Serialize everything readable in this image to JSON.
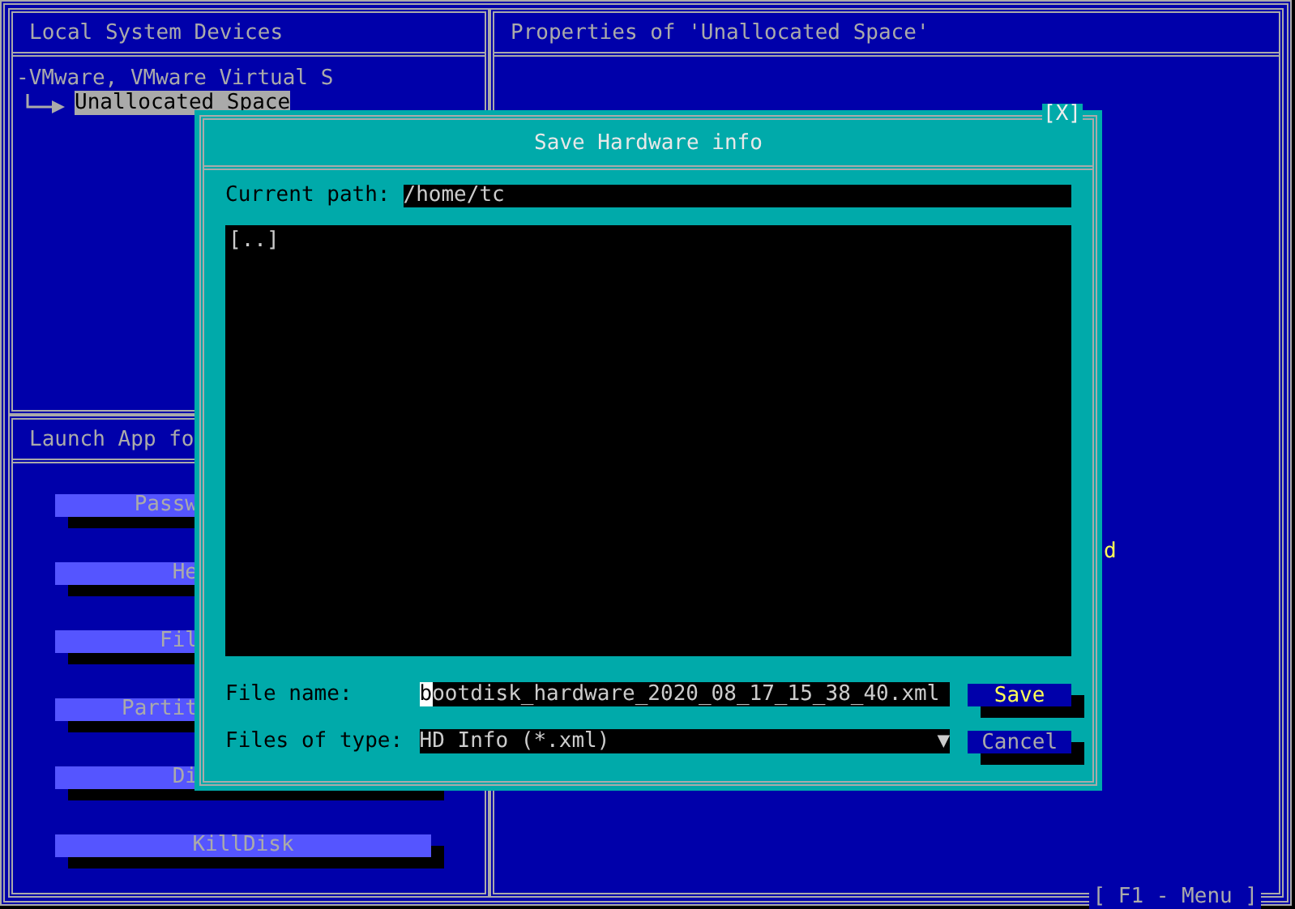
{
  "left_top_panel": {
    "title": "Local System Devices",
    "tree": [
      {
        "label": "-VMware, VMware Virtual S",
        "selected": false,
        "children": [
          {
            "label": "Unallocated Space",
            "selected": true
          }
        ]
      }
    ]
  },
  "left_bottom_panel": {
    "title": "Launch App fo",
    "buttons": [
      {
        "label": "Passw",
        "kind": "covered"
      },
      {
        "label": "He",
        "kind": "covered"
      },
      {
        "label": "Fil",
        "kind": "covered"
      },
      {
        "label": "Partit",
        "kind": "covered"
      },
      {
        "label": "Di",
        "kind": "covered"
      },
      {
        "label": "KillDisk",
        "kind": "full"
      }
    ]
  },
  "right_panel": {
    "title": "Properties of 'Unallocated Space'",
    "text": "d"
  },
  "dialog": {
    "title": "Save Hardware info",
    "close": "[X]",
    "current_path_label": "Current path:",
    "current_path": "/home/tc",
    "files": [
      "[..]"
    ],
    "file_name_label": "File name:",
    "file_name": "bootdisk_hardware_2020_08_17_15_38_40.xml",
    "file_type_label": "Files of type:",
    "file_type": "HD Info (*.xml)",
    "dropdown_arrow": "▼",
    "buttons": [
      {
        "label": "Save",
        "focused": true
      },
      {
        "label": "Cancel",
        "focused": false
      }
    ]
  },
  "status_bar": {
    "hint": "[ F1 - Menu ]"
  }
}
